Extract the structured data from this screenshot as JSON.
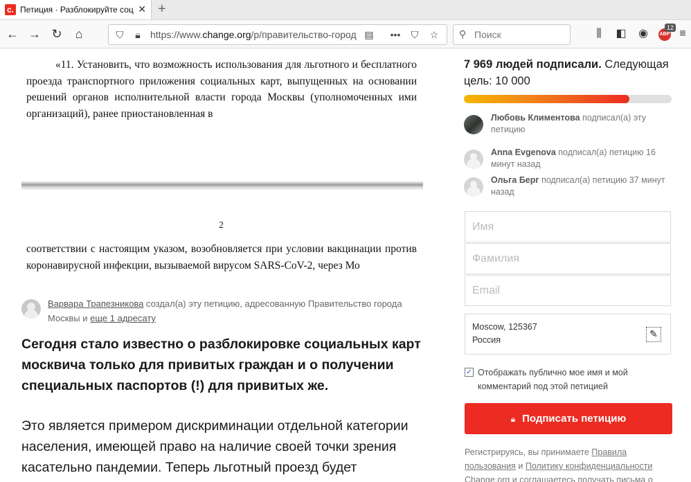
{
  "browser": {
    "tab_title": "Петиция · Разблокируйте соц",
    "favicon_letter": "c.",
    "url_prefix": "https://www.",
    "url_domain": "change.org",
    "url_path": "/p/правительство-город",
    "search_placeholder": "Поиск",
    "abp_label": "ABP",
    "abp_count": "12"
  },
  "document": {
    "paragraph1": "«11. Установить, что возможность использования для льготного и бесплатного проезда транспортного приложения социальных карт, выпущенных на основании решений органов исполнительной власти города Москвы (уполномоченных ими организаций), ранее приостановленная в",
    "page_number": "2",
    "paragraph2": "соответствии с настоящим указом, возобновляется при условии вакцинации против коронавирусной инфекции, вызываемой вирусом SARS-CoV-2, через Мо"
  },
  "creator": {
    "name": "Варвара Трапезникова",
    "text1": " создал(а) эту петицию, адресованную Правительство города Москвы и ",
    "link": "еще 1 адресату"
  },
  "petition": {
    "lead": "Сегодня стало известно о разблокировке социальных карт москвича только для привитых граждан и о получении специальных паспортов (!) для привитых же.",
    "body": "Это является примером дискриминации отдельной категории населения, имеющей право на наличие своей точки зрения касательно пандемии. Теперь льготный проезд будет"
  },
  "sidebar": {
    "count_bold": "7 969 людей подписали.",
    "count_rest": " Следующая цель: 10 000",
    "progress_fraction": 0.7969,
    "signers": [
      {
        "name": "Любовь Климентова",
        "action": " подписал(а) эту петицию"
      },
      {
        "name": "Anna Evgenova",
        "action": " подписал(а) петицию 16 минут назад"
      },
      {
        "name": "Ольга Берг",
        "action": " подписал(а) петицию 37 минут назад"
      }
    ],
    "form": {
      "first_name_placeholder": "Имя",
      "last_name_placeholder": "Фамилия",
      "email_placeholder": "Email",
      "address_line1": "Moscow, 125367",
      "address_line2": "Россия",
      "public_checkbox_label": "Отображать публично мое имя и мой комментарий под этой петицией",
      "public_checked": true
    },
    "sign_button": "Подписать петицию",
    "terms": {
      "t1": "Регистрируясь, вы принимаете ",
      "link1": "Правила пользования",
      "t2": " и ",
      "link2": "Политику конфиденциальности",
      "t3": " Change.org и соглашаетесь получать письма о"
    }
  },
  "colors": {
    "brand_red": "#ec2c22",
    "progress_start": "#f7b500"
  }
}
